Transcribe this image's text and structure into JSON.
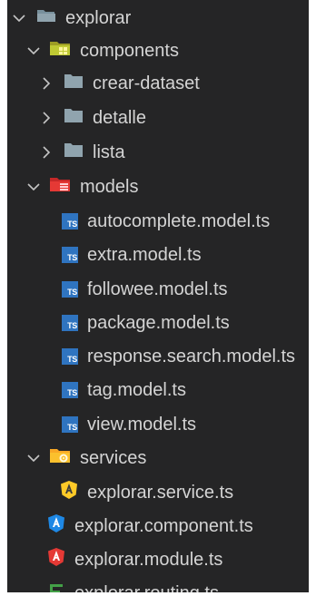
{
  "tree": {
    "root": {
      "label": "explorar",
      "chevron": "chevron-down-icon",
      "icon": "folder-open-icon"
    },
    "components": {
      "label": "components",
      "chevron": "chevron-down-icon",
      "icon": "folder-components-icon",
      "color": "#c0ca33"
    },
    "components_children": [
      {
        "label": "crear-dataset",
        "chevron": "chevron-right-icon",
        "icon": "folder-icon"
      },
      {
        "label": "detalle",
        "chevron": "chevron-right-icon",
        "icon": "folder-icon"
      },
      {
        "label": "lista",
        "chevron": "chevron-right-icon",
        "icon": "folder-icon"
      }
    ],
    "models": {
      "label": "models",
      "chevron": "chevron-down-icon",
      "icon": "folder-models-icon",
      "color": "#e53935"
    },
    "models_files": [
      {
        "label": "autocomplete.model.ts",
        "badge": "TS"
      },
      {
        "label": "extra.model.ts",
        "badge": "TS"
      },
      {
        "label": "followee.model.ts",
        "badge": "TS"
      },
      {
        "label": "package.model.ts",
        "badge": "TS"
      },
      {
        "label": "response.search.model.ts",
        "badge": "TS"
      },
      {
        "label": "tag.model.ts",
        "badge": "TS"
      },
      {
        "label": "view.model.ts",
        "badge": "TS"
      }
    ],
    "services": {
      "label": "services",
      "chevron": "chevron-down-icon",
      "icon": "folder-services-icon",
      "color": "#fbc02d"
    },
    "services_files": [
      {
        "label": "explorar.service.ts",
        "icon": "angular-service-icon",
        "color": "#ffca28"
      }
    ],
    "root_files": [
      {
        "label": "explorar.component.ts",
        "icon": "angular-component-icon",
        "color": "#1e88e5"
      },
      {
        "label": "explorar.module.ts",
        "icon": "angular-module-icon",
        "color": "#e53935"
      },
      {
        "label": "explorar.routing.ts",
        "icon": "angular-routing-icon",
        "color": "#43a047"
      }
    ]
  },
  "colors": {
    "panel_bg": "#252526",
    "text": "#d4d4d4",
    "chevron": "#c5c5c5",
    "folder_grey": "#90a4ae",
    "ts_badge": "#2f74c0"
  }
}
